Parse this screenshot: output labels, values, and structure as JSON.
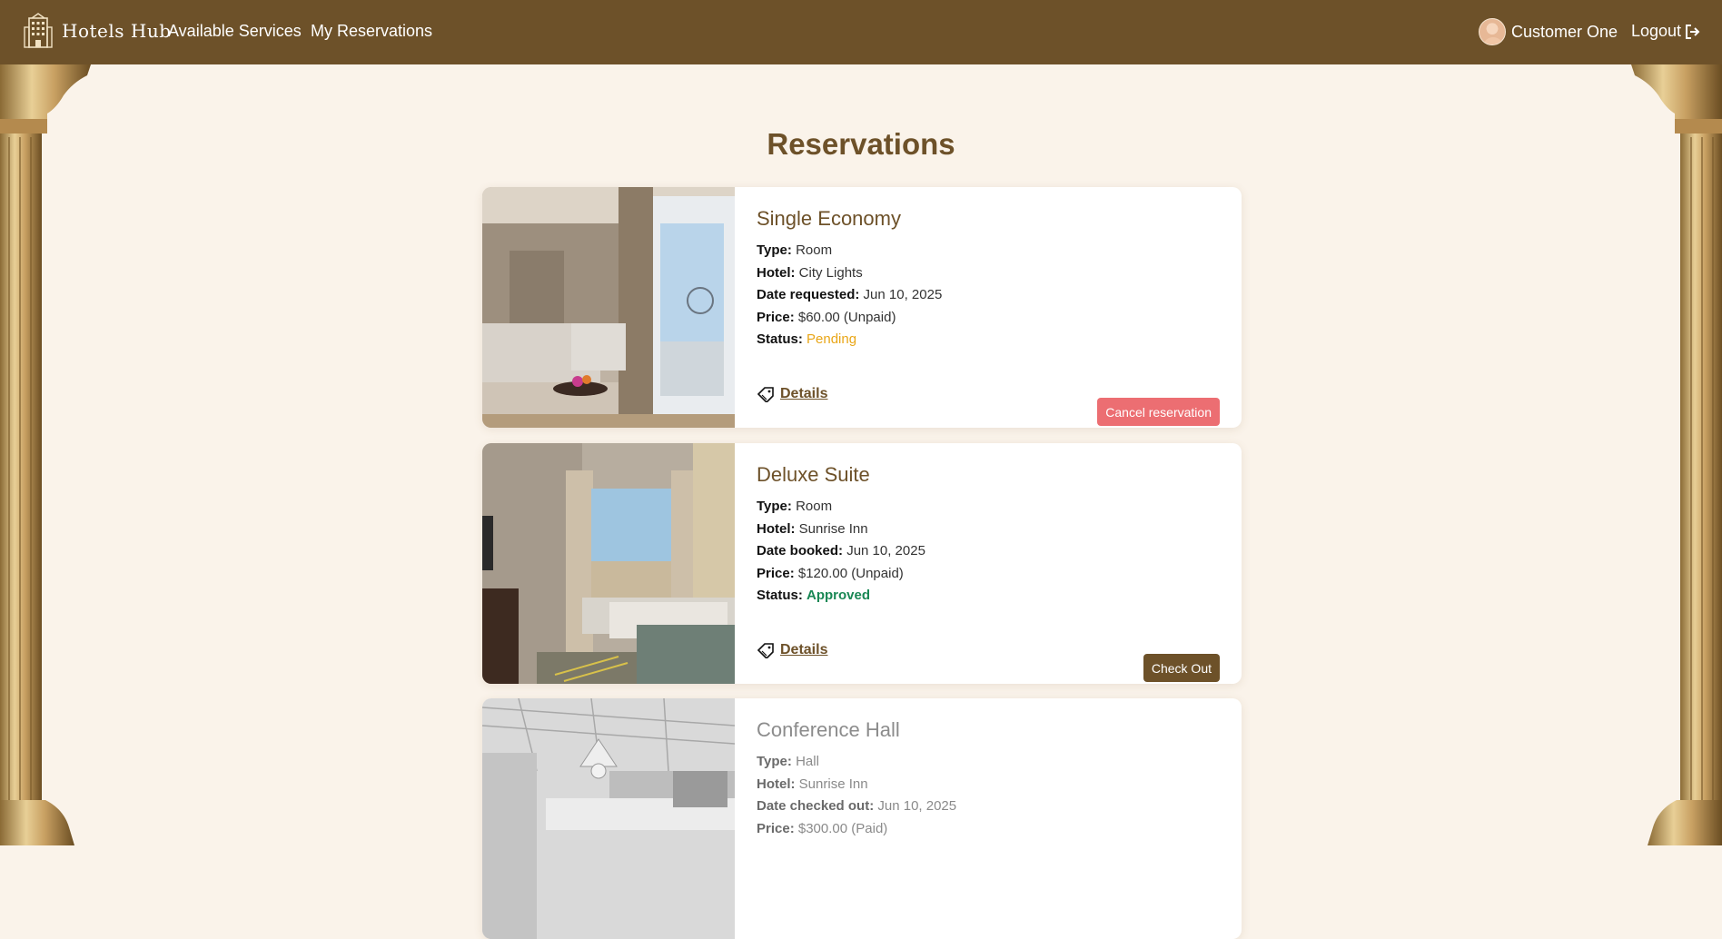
{
  "navbar": {
    "brand": "Hotels Hub",
    "links": [
      "Available Services",
      "My Reservations"
    ],
    "user_name": "Customer One",
    "logout": "Logout"
  },
  "page": {
    "title": "Reservations"
  },
  "reservations": [
    {
      "title": "Single Economy",
      "fields": [
        {
          "label": "Type:",
          "value": "Room"
        },
        {
          "label": "Hotel:",
          "value": "City Lights"
        },
        {
          "label": "Date requested:",
          "value": "Jun 10, 2025"
        },
        {
          "label": "Price:",
          "value": "$60.00 (Unpaid)"
        },
        {
          "label": "Status:",
          "value": "Pending"
        }
      ],
      "details": "Details",
      "action": "Cancel reservation"
    },
    {
      "title": "Deluxe Suite",
      "fields": [
        {
          "label": "Type:",
          "value": "Room"
        },
        {
          "label": "Hotel:",
          "value": "Sunrise Inn"
        },
        {
          "label": "Date booked:",
          "value": "Jun 10, 2025"
        },
        {
          "label": "Price:",
          "value": "$120.00 (Unpaid)"
        },
        {
          "label": "Status:",
          "value": "Approved"
        }
      ],
      "details": "Details",
      "action": "Check Out"
    },
    {
      "title": "Conference Hall",
      "fields": [
        {
          "label": "Type:",
          "value": "Hall"
        },
        {
          "label": "Hotel:",
          "value": "Sunrise Inn"
        },
        {
          "label": "Date checked out:",
          "value": "Jun 10, 2025"
        },
        {
          "label": "Price:",
          "value": "$300.00 (Paid)"
        }
      ]
    }
  ],
  "colors": {
    "navbar": "#6d5129",
    "background": "#faf3ea",
    "pending": "#e9a617",
    "approved": "#198754",
    "cancel_button": "#ec6e72",
    "checkout_button": "#6d5129"
  },
  "icons": {
    "brand": "hotel-building-icon",
    "logout": "sign-out-icon",
    "details": "ticket-icon"
  }
}
